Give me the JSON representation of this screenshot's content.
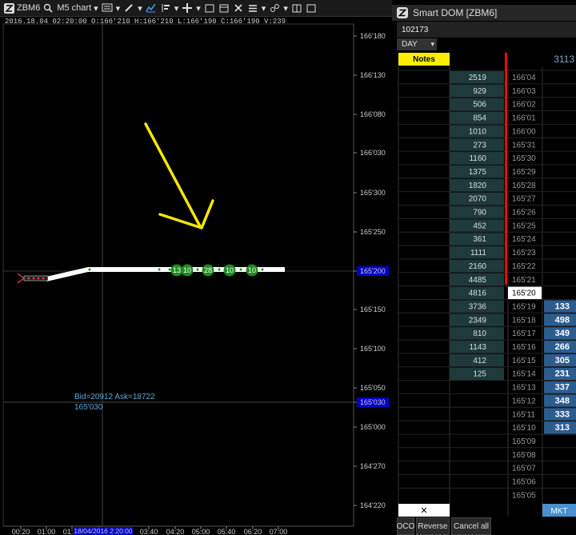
{
  "toolbar": {
    "symbol": "ZBM6",
    "timeframe": "M5 chart"
  },
  "ohlc_line": "2016.18.04 02:20:00   O:166'210   H:166'210   L:166'190   C:166'190   V:239",
  "price_axis": [
    "166'180",
    "166'130",
    "166'080",
    "166'030",
    "165'300",
    "165'250",
    "165'200",
    "165'150",
    "165'100",
    "165'050",
    "165'030",
    "165'000",
    "164'270",
    "164'220"
  ],
  "price_markers": {
    "current": "165'200",
    "crosshair": "165'030"
  },
  "time_axis": [
    "00:20",
    "01:00",
    "01:40",
    "02:20",
    "03:40",
    "04:20",
    "05:00",
    "05:40",
    "06:20",
    "07:00"
  ],
  "crosshair_date_label": "18/04/2016 2:20:00",
  "bid_ask_label": "Bid=20912 Ask=18722",
  "crosshair_price_label": "165'030",
  "bubbles": [
    "13",
    "10",
    "28",
    "10",
    "10"
  ],
  "dom": {
    "title": "Smart DOM [ZBM6]",
    "account": "102173",
    "tif": "DAY",
    "notes_label": "Notes",
    "top_right_value": "3113",
    "rows": [
      {
        "bid": "2519",
        "price": "166'04",
        "ask": ""
      },
      {
        "bid": "929",
        "price": "166'03",
        "ask": ""
      },
      {
        "bid": "506",
        "price": "166'02",
        "ask": ""
      },
      {
        "bid": "854",
        "price": "166'01",
        "ask": ""
      },
      {
        "bid": "1010",
        "price": "166'00",
        "ask": ""
      },
      {
        "bid": "273",
        "price": "165'31",
        "ask": ""
      },
      {
        "bid": "1160",
        "price": "165'30",
        "ask": ""
      },
      {
        "bid": "1375",
        "price": "165'29",
        "ask": ""
      },
      {
        "bid": "1820",
        "price": "165'28",
        "ask": ""
      },
      {
        "bid": "2070",
        "price": "165'27",
        "ask": ""
      },
      {
        "bid": "790",
        "price": "165'26",
        "ask": ""
      },
      {
        "bid": "452",
        "price": "165'25",
        "ask": ""
      },
      {
        "bid": "361",
        "price": "165'24",
        "ask": ""
      },
      {
        "bid": "1111",
        "price": "165'23",
        "ask": ""
      },
      {
        "bid": "2160",
        "price": "165'22",
        "ask": ""
      },
      {
        "bid": "4485",
        "price": "165'21",
        "ask": ""
      },
      {
        "bid": "4816",
        "price": "165'20",
        "ask": ""
      },
      {
        "bid": "3736",
        "price": "165'19",
        "ask": "133"
      },
      {
        "bid": "2349",
        "price": "165'18",
        "ask": "498"
      },
      {
        "bid": "810",
        "price": "165'17",
        "ask": "349"
      },
      {
        "bid": "1143",
        "price": "165'16",
        "ask": "266"
      },
      {
        "bid": "412",
        "price": "165'15",
        "ask": "305"
      },
      {
        "bid": "125",
        "price": "165'14",
        "ask": "231"
      },
      {
        "bid": "",
        "price": "165'13",
        "ask": "337"
      },
      {
        "bid": "",
        "price": "165'12",
        "ask": "348"
      },
      {
        "bid": "",
        "price": "165'11",
        "ask": "333"
      },
      {
        "bid": "",
        "price": "165'10",
        "ask": "313"
      },
      {
        "bid": "",
        "price": "165'09",
        "ask": ""
      },
      {
        "bid": "",
        "price": "165'08",
        "ask": ""
      },
      {
        "bid": "",
        "price": "165'07",
        "ask": ""
      },
      {
        "bid": "",
        "price": "165'06",
        "ask": ""
      },
      {
        "bid": "",
        "price": "165'05",
        "ask": ""
      }
    ],
    "cancel_x": "✕",
    "mkt_label": "MKT",
    "buttons": [
      "OCO",
      "Reverse",
      "Cancel all"
    ]
  },
  "colors": {
    "arrow": "#f5e600",
    "bubble": "#1f8a1f",
    "ask_bg": "#2d5d8e",
    "bid_bg": "#1e3a3a",
    "last_trade": "#ffffff",
    "price_marker": "#0000cc"
  }
}
